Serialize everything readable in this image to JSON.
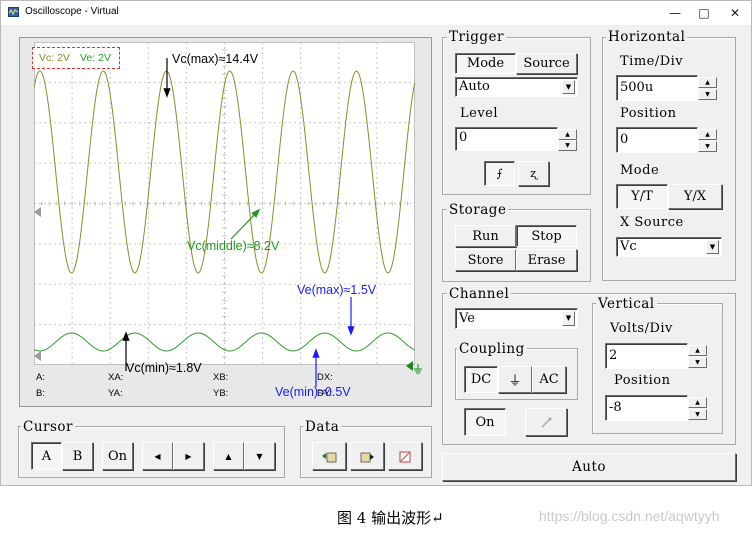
{
  "window": {
    "title": "Oscilloscope - Virtual",
    "minimize": "—",
    "maximize": "□",
    "close": "✕"
  },
  "scope": {
    "channel_tags": {
      "vc": "Vc: 2V",
      "ve": "Ve: 2V"
    },
    "annotations": {
      "vc_max": "Vc(max)≈14.4V",
      "vc_middle": "Vc(middle)≈8.2V",
      "vc_min": "Vc(min)≈1.8V",
      "ve_max": "Ve(max)≈1.5V",
      "ve_min": "Ve(min)≈0.5V"
    },
    "measurements": {
      "a": "A:",
      "b": "B:",
      "xa": "XA:",
      "ya": "YA:",
      "xb": "XB:",
      "yb": "YB:",
      "dx": "DX:",
      "dy": "DY:"
    },
    "colors": {
      "vc": "#8b8b2e",
      "ve": "#2e9b2e",
      "annot_black": "#000000",
      "annot_green": "#1f9b1f",
      "annot_blue": "#1a1aff",
      "tag_box": "#e03030"
    }
  },
  "trigger": {
    "title": "Trigger",
    "mode": "Mode",
    "source": "Source",
    "select_value": "Auto",
    "level_label": "Level",
    "level_value": "0",
    "rising_icon": "rising-edge-icon",
    "falling_icon": "falling-edge-icon"
  },
  "horizontal": {
    "title": "Horizontal",
    "time_label": "Time/Div",
    "time_value": "500u",
    "position_label": "Position",
    "position_value": "0",
    "mode_label": "Mode",
    "yt": "Y/T",
    "yx": "Y/X",
    "xsource_label": "X Source",
    "xsource_value": "Vc"
  },
  "storage": {
    "title": "Storage",
    "run": "Run",
    "stop": "Stop",
    "store": "Store",
    "erase": "Erase"
  },
  "channel": {
    "title": "Channel",
    "select_value": "Ve",
    "coupling_label": "Coupling",
    "dc": "DC",
    "gnd": "⏚",
    "ac": "AC",
    "on": "On"
  },
  "vertical": {
    "title": "Vertical",
    "volts_label": "Volts/Div",
    "volts_value": "2",
    "position_label": "Position",
    "position_value": "-8"
  },
  "cursor": {
    "title": "Cursor",
    "a": "A",
    "b": "B",
    "on": "On"
  },
  "data": {
    "title": "Data"
  },
  "auto": "Auto",
  "caption": "图 4  输出波形↵",
  "watermark": "https://blog.csdn.net/aqwtyyh"
}
